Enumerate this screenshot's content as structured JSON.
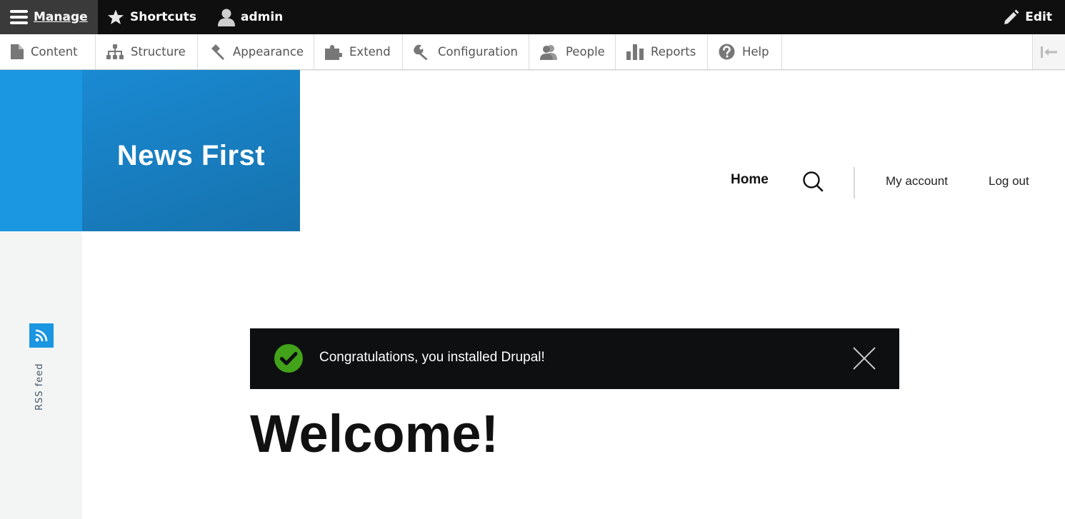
{
  "toolbar": {
    "manage_label": "Manage",
    "shortcuts_label": "Shortcuts",
    "user_label": "admin",
    "edit_label": "Edit"
  },
  "tray": {
    "items": [
      {
        "label": "Content",
        "icon": "file-icon"
      },
      {
        "label": "Structure",
        "icon": "sitemap-icon"
      },
      {
        "label": "Appearance",
        "icon": "paintbrush-icon"
      },
      {
        "label": "Extend",
        "icon": "puzzle-icon"
      },
      {
        "label": "Configuration",
        "icon": "wrench-icon"
      },
      {
        "label": "People",
        "icon": "people-icon"
      },
      {
        "label": "Reports",
        "icon": "bar-chart-icon"
      },
      {
        "label": "Help",
        "icon": "help-icon"
      }
    ]
  },
  "site": {
    "name": "News First"
  },
  "nav": {
    "home_label": "Home",
    "my_account_label": "My account",
    "logout_label": "Log out"
  },
  "rss": {
    "label": "RSS feed"
  },
  "message": {
    "text": "Congratulations, you installed Drupal!"
  },
  "page": {
    "title": "Welcome!"
  },
  "colors": {
    "toolbar_bg": "#0f0f0f",
    "brand_blue": "#1b96e0",
    "message_bg": "#0d0f11",
    "success_green": "#42a21a"
  }
}
